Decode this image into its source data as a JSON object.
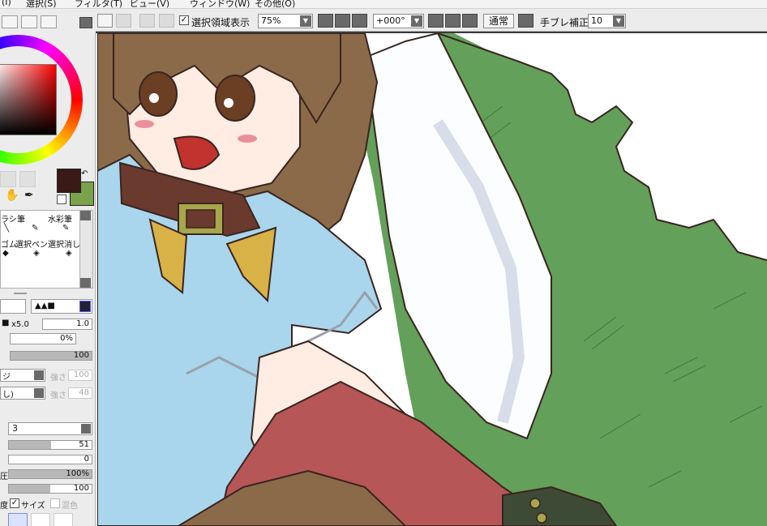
{
  "menu": [
    "(I)",
    "選択(S)",
    "フィルタ(T)",
    "ビュー(V)",
    "ウィンドウ(W)",
    "その他(O)"
  ],
  "toolbar": {
    "show_selection_label": "選択領域表示",
    "show_selection_checked": true,
    "zoom": "75%",
    "rotation": "+000°",
    "blend_button": "通常",
    "stabilizer_label": "手ブレ補正",
    "stabilizer_value": "10"
  },
  "colors": {
    "foreground": "#3a1a16",
    "background": "#7aa24a"
  },
  "tools": {
    "row1": [
      "ラシ",
      "筆",
      "水彩筆"
    ],
    "row2": [
      "ゴム",
      "選択ペン",
      "選択消し"
    ]
  },
  "brush": {
    "size_multiplier": "x5.0",
    "size_value": "1.0",
    "min_size": "0%",
    "density": "100",
    "strength1_label": "強さ",
    "strength1_value": "100",
    "strength2_label": "強さ",
    "strength2_value": "48",
    "mix_left1": "ジ",
    "mix_left2": "し)",
    "texture_value": "3",
    "blur": "51",
    "blending": "0",
    "pressure_label": "圧",
    "pressure_value": "100%",
    "persistence": "100",
    "density_label": "度",
    "size_label": "サイズ",
    "size_checked": true,
    "mix_label": "混色",
    "mix_checked": false
  },
  "canvas": {
    "hair": "#8a6a48",
    "skin": "#ffece2",
    "shirt": "#a9d6ec",
    "collar": "#6b3a2e",
    "bush": "#63a05a",
    "red_fabric": "#b65656",
    "line": "#3a2420"
  }
}
